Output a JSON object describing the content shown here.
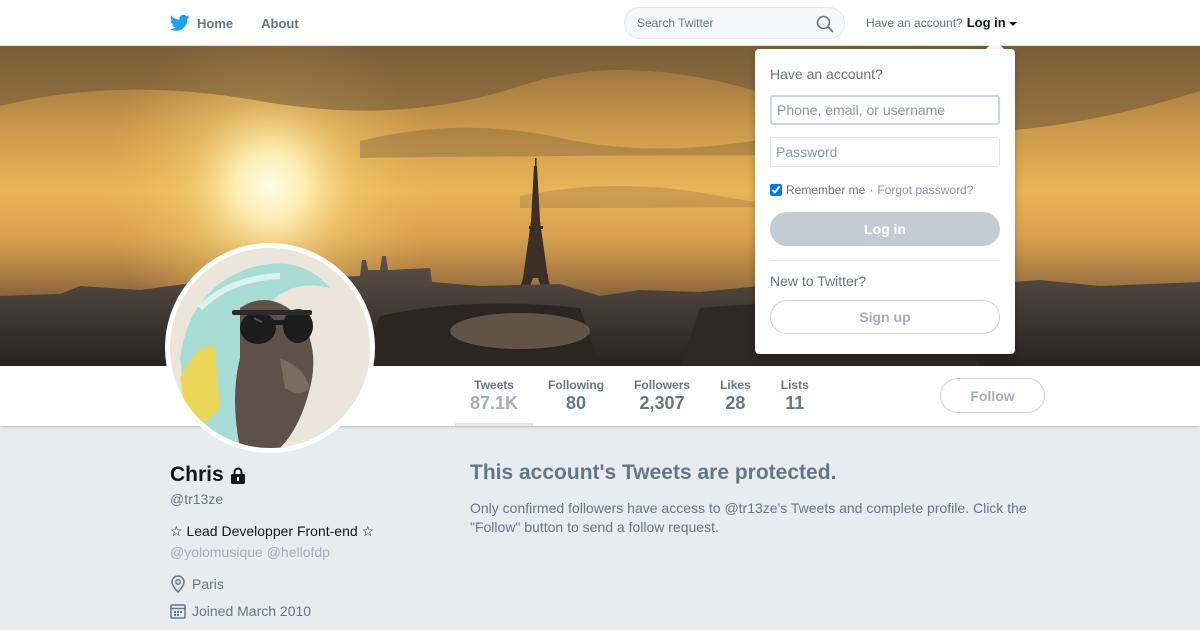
{
  "nav": {
    "home_label": "Home",
    "about_label": "About",
    "search_placeholder": "Search Twitter",
    "have_account": "Have an account?",
    "login_label": "Log in"
  },
  "colors": {
    "brand": "#1da1f2",
    "muted": "#657786",
    "background": "#e6ecf0"
  },
  "profile": {
    "name": "Chris",
    "handle": "@tr13ze",
    "bio": "☆ Lead Developper Front-end ☆",
    "bio_mentions": [
      "@yolomusique",
      "@hellofdp"
    ],
    "location": "Paris",
    "joined": "Joined March 2010"
  },
  "stats": [
    {
      "label": "Tweets",
      "value": "87.1K"
    },
    {
      "label": "Following",
      "value": "80"
    },
    {
      "label": "Followers",
      "value": "2,307"
    },
    {
      "label": "Likes",
      "value": "28"
    },
    {
      "label": "Lists",
      "value": "11"
    }
  ],
  "follow_label": "Follow",
  "protected": {
    "title": "This account's Tweets are protected.",
    "text": "Only confirmed followers have access to @tr13ze's Tweets and complete profile. Click the \"Follow\" button to send a follow request."
  },
  "login_dropdown": {
    "title": "Have an account?",
    "username_placeholder": "Phone, email, or username",
    "password_placeholder": "Password",
    "remember_label": "Remember me",
    "remember_checked": true,
    "separator": "·",
    "forgot_label": "Forgot password?",
    "login_button": "Log in",
    "new_label": "New to Twitter?",
    "signup_button": "Sign up"
  },
  "icons": {
    "logo": "twitter-bird-icon",
    "search": "search-icon",
    "lock": "lock-icon",
    "location": "location-pin-icon",
    "calendar": "calendar-icon"
  }
}
